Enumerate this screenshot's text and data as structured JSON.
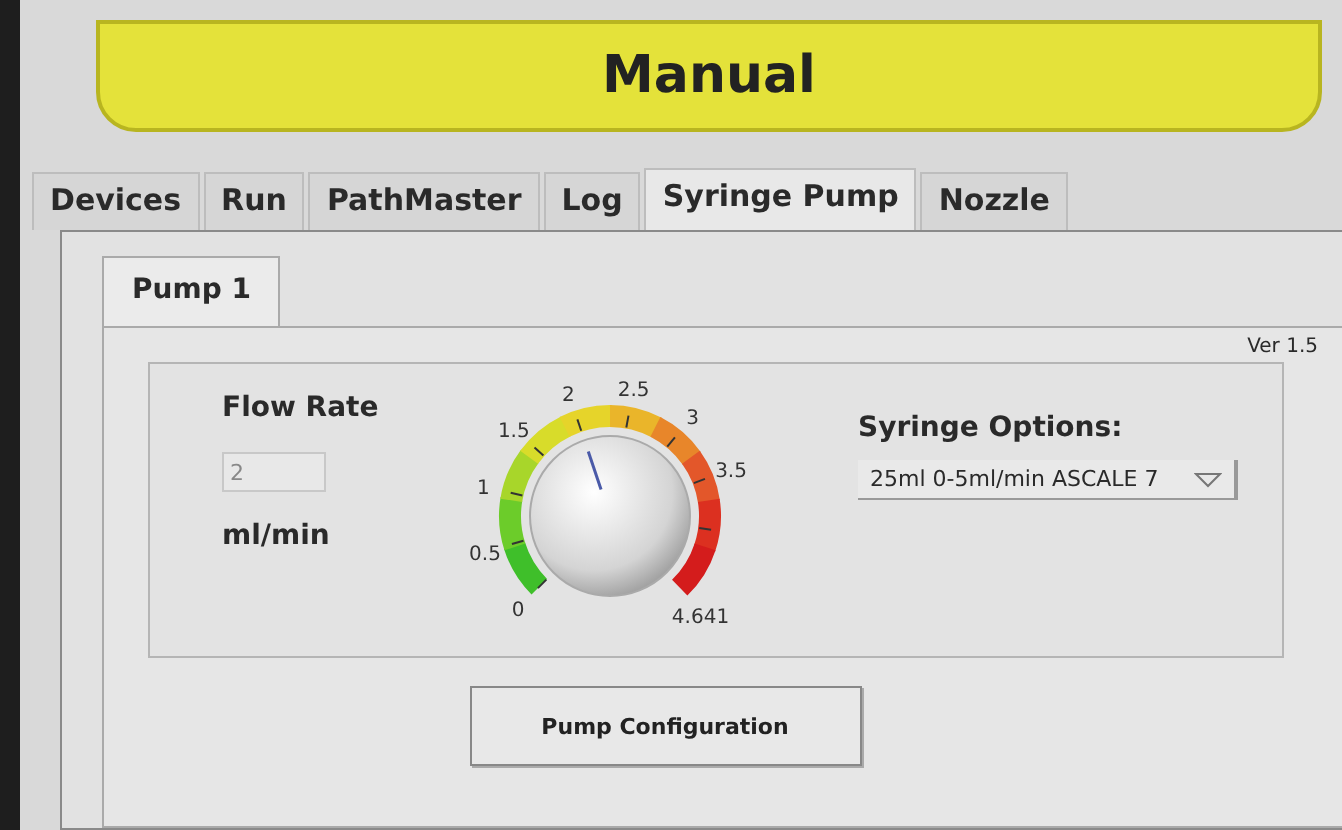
{
  "header": {
    "title": "Manual"
  },
  "tabs": [
    {
      "label": "Devices",
      "selected": false
    },
    {
      "label": "Run",
      "selected": false
    },
    {
      "label": "PathMaster",
      "selected": false
    },
    {
      "label": "Log",
      "selected": false
    },
    {
      "label": "Syringe Pump",
      "selected": true
    },
    {
      "label": "Nozzle",
      "selected": false
    }
  ],
  "sub_tabs": [
    {
      "label": "Pump 1",
      "selected": true
    }
  ],
  "version": "Ver 1.5",
  "flow_rate": {
    "label": "Flow Rate",
    "value": "2",
    "unit": "ml/min"
  },
  "knob": {
    "scale_labels": [
      "0",
      "0.5",
      "1",
      "1.5",
      "2",
      "2.5",
      "3",
      "3.5"
    ],
    "max_label": "4.641",
    "level": 0.431
  },
  "syringe_options": {
    "label": "Syringe Options:",
    "value": "25ml 0-5ml/min ASCALE 7"
  },
  "buttons": [
    "Pump Configuration"
  ]
}
